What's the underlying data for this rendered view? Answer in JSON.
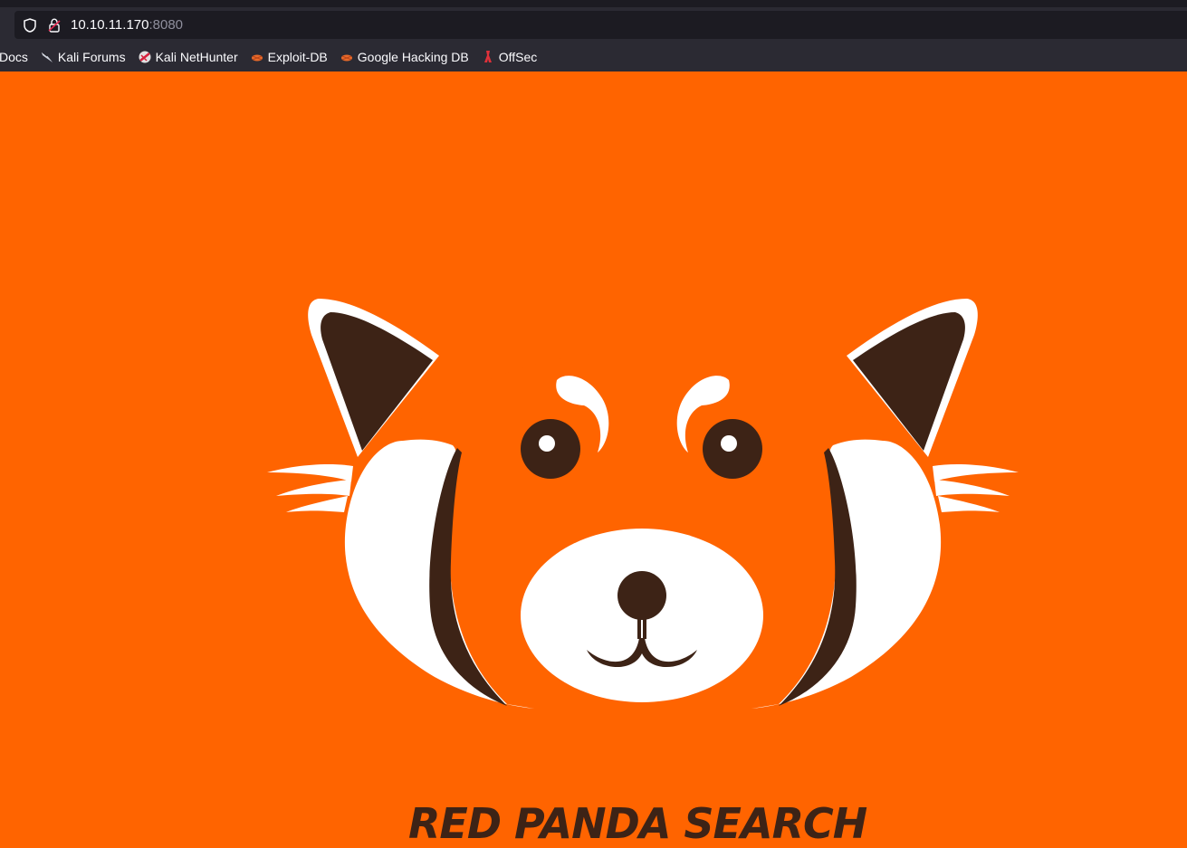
{
  "browser": {
    "url_host": "10.10.11.170",
    "url_port": ":8080",
    "bookmarks": [
      {
        "label": "Docs",
        "icon": "kali-docs-icon"
      },
      {
        "label": "Kali Forums",
        "icon": "kali-dragon-icon"
      },
      {
        "label": "Kali NetHunter",
        "icon": "nethunter-icon"
      },
      {
        "label": "Exploit-DB",
        "icon": "exploitdb-icon"
      },
      {
        "label": "Google Hacking DB",
        "icon": "ghdb-icon"
      },
      {
        "label": "OffSec",
        "icon": "offsec-icon"
      }
    ]
  },
  "page": {
    "title": "RED PANDA SEARCH",
    "colors": {
      "background": "#ff6400",
      "dark_brown": "#3d2316",
      "white": "#ffffff"
    }
  }
}
